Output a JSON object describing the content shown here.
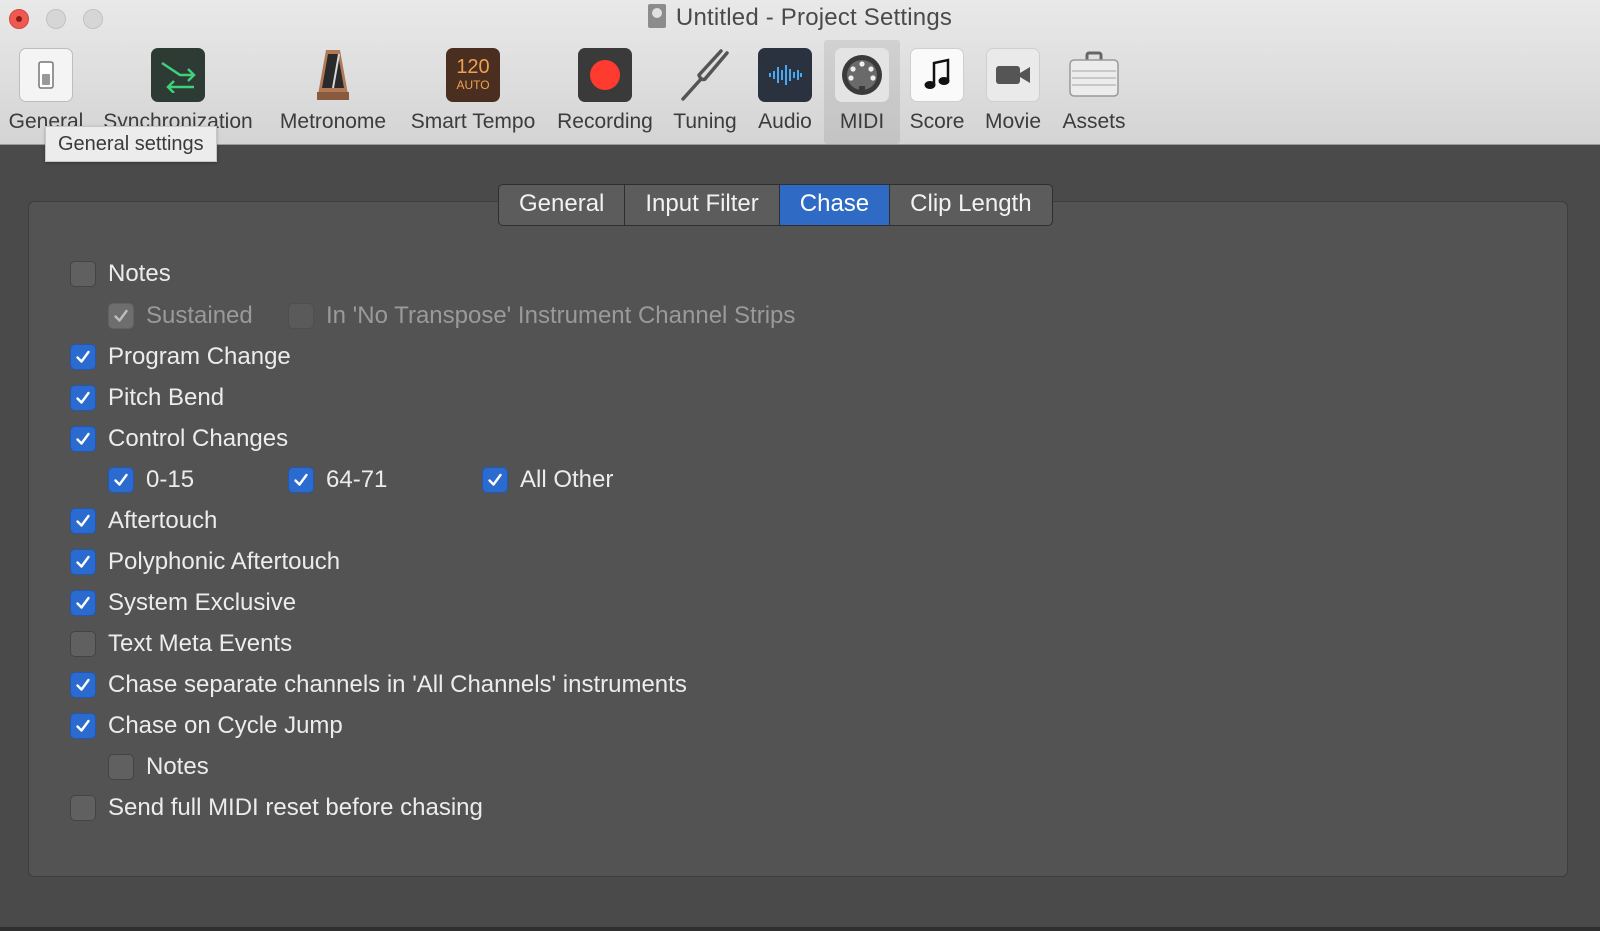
{
  "window": {
    "title": "Untitled - Project Settings"
  },
  "tooltip": "General settings",
  "toolbar": [
    {
      "id": "general",
      "label": "General",
      "icon": "general-switch-icon"
    },
    {
      "id": "synchronization",
      "label": "Synchronization",
      "icon": "sync-arrows-icon"
    },
    {
      "id": "metronome",
      "label": "Metronome",
      "icon": "metronome-icon"
    },
    {
      "id": "smart-tempo",
      "label": "Smart Tempo",
      "icon": "tempo-icon",
      "icon_text_top": "120",
      "icon_text_bottom": "AUTO"
    },
    {
      "id": "recording",
      "label": "Recording",
      "icon": "record-icon"
    },
    {
      "id": "tuning",
      "label": "Tuning",
      "icon": "tuning-fork-icon"
    },
    {
      "id": "audio",
      "label": "Audio",
      "icon": "waveform-icon"
    },
    {
      "id": "midi",
      "label": "MIDI",
      "icon": "midi-connector-icon",
      "selected": true
    },
    {
      "id": "score",
      "label": "Score",
      "icon": "music-note-icon"
    },
    {
      "id": "movie",
      "label": "Movie",
      "icon": "video-camera-icon"
    },
    {
      "id": "assets",
      "label": "Assets",
      "icon": "briefcase-icon"
    }
  ],
  "tabs": [
    {
      "label": "General",
      "active": false
    },
    {
      "label": "Input Filter",
      "active": false
    },
    {
      "label": "Chase",
      "active": true
    },
    {
      "label": "Clip Length",
      "active": false
    }
  ],
  "options": {
    "notes": {
      "label": "Notes",
      "checked": false
    },
    "sustained": {
      "label": "Sustained",
      "checked": true,
      "disabled": true
    },
    "no_transpose": {
      "label": "In 'No Transpose' Instrument Channel Strips",
      "checked": false,
      "disabled": true
    },
    "program_change": {
      "label": "Program Change",
      "checked": true
    },
    "pitch_bend": {
      "label": "Pitch Bend",
      "checked": true
    },
    "control_changes": {
      "label": "Control Changes",
      "checked": true
    },
    "cc_0_15": {
      "label": "0-15",
      "checked": true
    },
    "cc_64_71": {
      "label": "64-71",
      "checked": true
    },
    "cc_all_other": {
      "label": "All Other",
      "checked": true
    },
    "aftertouch": {
      "label": "Aftertouch",
      "checked": true
    },
    "poly_aftertouch": {
      "label": "Polyphonic Aftertouch",
      "checked": true
    },
    "sysex": {
      "label": "System Exclusive",
      "checked": true
    },
    "text_meta": {
      "label": "Text Meta Events",
      "checked": false
    },
    "chase_separate": {
      "label": "Chase separate channels in 'All Channels' instruments",
      "checked": true
    },
    "chase_cycle": {
      "label": "Chase on Cycle Jump",
      "checked": true
    },
    "cycle_notes": {
      "label": "Notes",
      "checked": false
    },
    "midi_reset": {
      "label": "Send full MIDI reset before chasing",
      "checked": false
    }
  },
  "colors": {
    "accent": "#2b6bd0",
    "active_tab": "#2f6bc4",
    "record_red": "#ff3b30"
  }
}
